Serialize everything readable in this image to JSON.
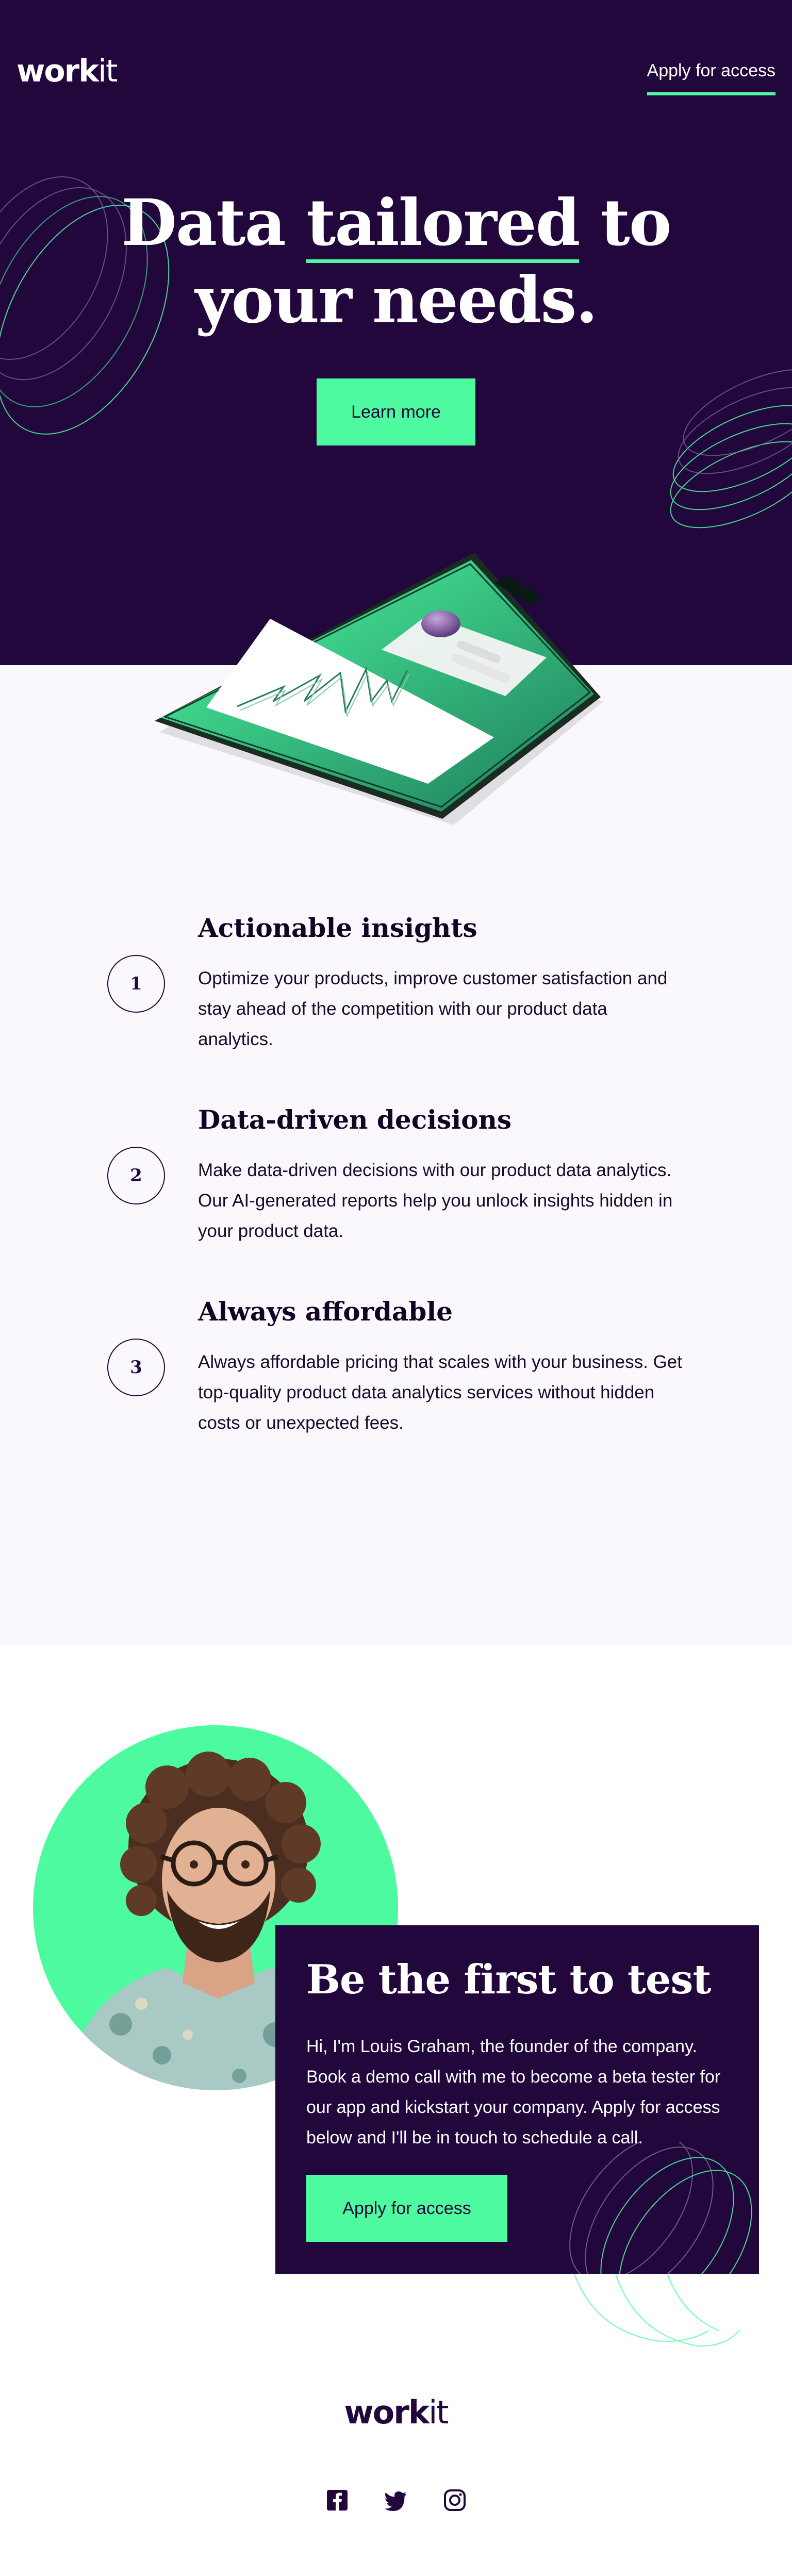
{
  "brand": {
    "bold": "work",
    "light": "it",
    "color": "#22073d"
  },
  "colors": {
    "accent": "#4dfaa0",
    "dark": "#22073d",
    "light_bg": "#faf7fd"
  },
  "nav": {
    "apply_label": "Apply for access"
  },
  "hero": {
    "title_part1": "Data",
    "title_highlight": "tailored",
    "title_part2": "to",
    "title_line2": "your needs.",
    "button_label": "Learn more"
  },
  "features": [
    {
      "number": "1",
      "title": "Actionable insights",
      "text": "Optimize your products, improve customer satisfaction and stay ahead of the competition with our product data analytics."
    },
    {
      "number": "2",
      "title": "Data-driven decisions",
      "text": "Make data-driven decisions with our product data analytics. Our AI-generated reports help you unlock insights hidden in your product data."
    },
    {
      "number": "3",
      "title": "Always affordable",
      "text": "Always affordable pricing that scales with your business. Get top-quality product data analytics services without hidden costs or unexpected fees."
    }
  ],
  "cta": {
    "title": "Be the first to test",
    "text": "Hi, I'm Louis Graham, the founder of the company. Book a demo call with me to become a beta tester for our app and kickstart your company. Apply for access below and I'll be in touch to schedule a call.",
    "button_label": "Apply for access"
  },
  "footer": {
    "socials": [
      "facebook-icon",
      "twitter-icon",
      "instagram-icon"
    ]
  }
}
